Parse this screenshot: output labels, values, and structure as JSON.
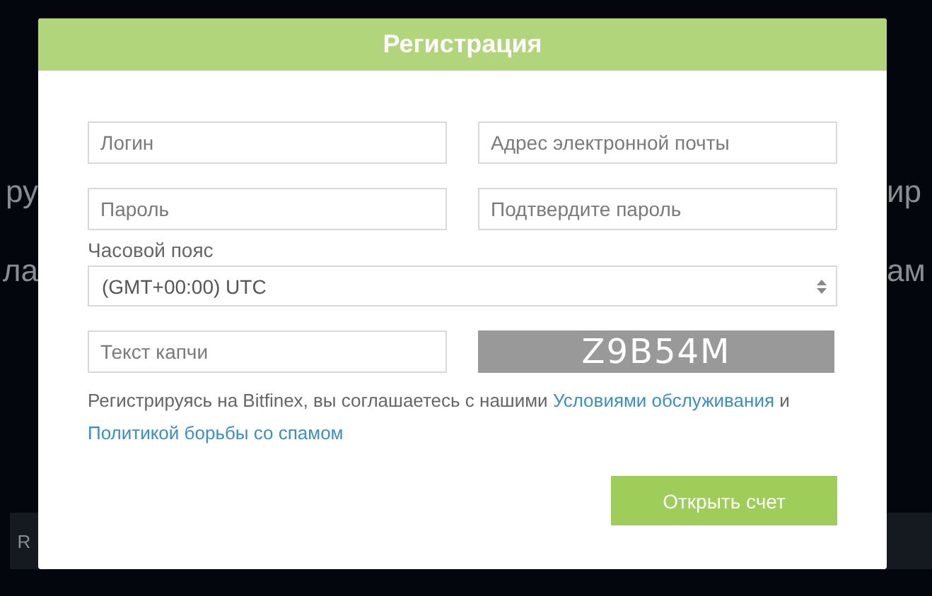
{
  "background": {
    "left_lines": [
      "ру",
      "ла"
    ],
    "right_lines": [
      "ир",
      "ам"
    ],
    "bottom_left": "R"
  },
  "modal": {
    "title": "Регистрация",
    "fields": [
      {
        "placeholder": "Логин"
      },
      {
        "placeholder": "Адрес электронной почты"
      },
      {
        "placeholder": "Пароль"
      },
      {
        "placeholder": "Подтвердите пароль"
      }
    ],
    "timezone": {
      "label": "Часовой пояс",
      "value": "(GMT+00:00) UTC"
    },
    "captcha_field": {
      "placeholder": "Текст капчи"
    },
    "captcha": "Z9B54M",
    "terms": {
      "text": "Регистрируясь на Bitfinex, вы соглашаетесь с нашими ",
      "link1": "Условиями обслуживания",
      "middle": " и ",
      "link2": "Политикой борьбы со спамом"
    },
    "submit": "Открыть счет"
  }
}
